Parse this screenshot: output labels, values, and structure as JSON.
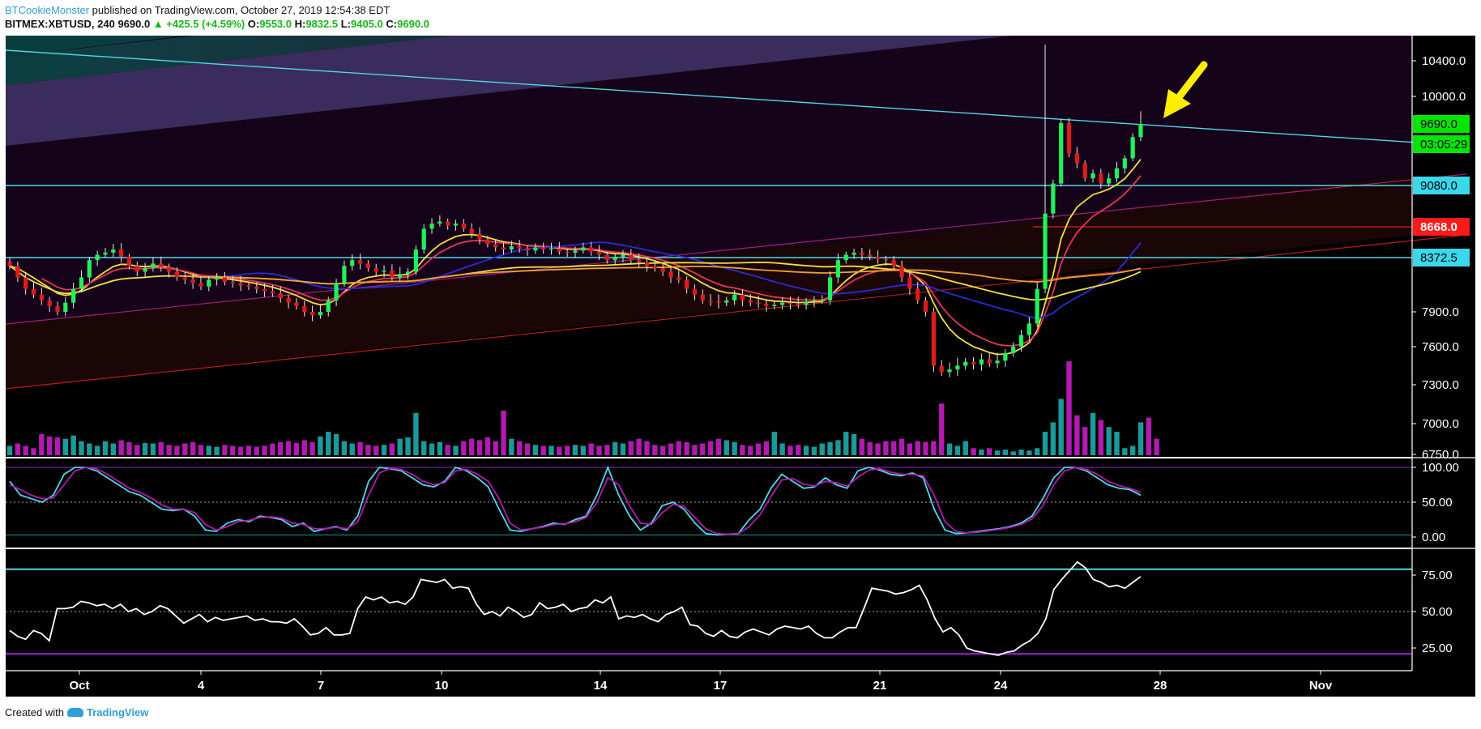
{
  "header": {
    "author": "BTCookieMonster",
    "published": "published on TradingView.com, October 27, 2019 12:54:38 EDT",
    "symbol": "BITMEX:XBTUSD, 240",
    "last": "9690.0",
    "change": "▲ +425.5 (+4.59%)",
    "o_label": "O:",
    "o_val": "9553.0",
    "h_label": "H:",
    "h_val": "9832.5",
    "l_label": "L:",
    "l_val": "9405.0",
    "c_label": "C:",
    "c_val": "9690.0"
  },
  "footer": {
    "created": "Created with",
    "brand": "TradingView"
  },
  "colors": {
    "background": "#000000",
    "up": "#1ef25a",
    "down": "#e01b1b",
    "cyan": "#4fd8e8",
    "yellow": "#f5df3c",
    "red_ma": "#e8345a",
    "blue_ma": "#2b2bd9",
    "orange_ma": "#f0a030",
    "white": "#ffffff",
    "magenta": "#b21ab2",
    "teal": "#1a9a9a",
    "purple": "#a020e0",
    "arrow": "#ffee00"
  },
  "chart_data": [
    {
      "type": "candlestick",
      "name": "price",
      "x_ticks": [
        "Oct",
        "4",
        "7",
        "10",
        "14",
        "17",
        "21",
        "24",
        "28",
        "Nov"
      ],
      "y_ticks": [
        "10400.0",
        "10000.0",
        "7900.0",
        "7600.0",
        "7300.0",
        "7000.0",
        "6750.0"
      ],
      "ylim": [
        6750,
        10700
      ],
      "price_labels": [
        {
          "text": "9690.0",
          "value": 9690,
          "style": "last"
        },
        {
          "text": "03:05:29",
          "value": 9560,
          "style": "timer"
        },
        {
          "text": "9080.0",
          "value": 9080,
          "style": "level"
        },
        {
          "text": "8668.0",
          "value": 8668,
          "style": "red-level"
        },
        {
          "text": "8372.5",
          "value": 8372.5,
          "style": "level"
        }
      ],
      "horizontal_levels": [
        9080,
        8372.5,
        8668
      ],
      "closes": [
        8300,
        8200,
        8100,
        8050,
        8000,
        7950,
        7900,
        7980,
        8100,
        8200,
        8350,
        8400,
        8420,
        8450,
        8380,
        8300,
        8250,
        8280,
        8320,
        8290,
        8250,
        8200,
        8180,
        8150,
        8120,
        8180,
        8200,
        8160,
        8150,
        8130,
        8120,
        8100,
        8080,
        8060,
        8020,
        7980,
        7950,
        7900,
        7870,
        7900,
        8000,
        8150,
        8300,
        8350,
        8320,
        8280,
        8250,
        8260,
        8200,
        8230,
        8250,
        8450,
        8650,
        8700,
        8720,
        8680,
        8700,
        8650,
        8600,
        8550,
        8500,
        8470,
        8450,
        8480,
        8460,
        8440,
        8470,
        8450,
        8460,
        8430,
        8420,
        8440,
        8470,
        8430,
        8400,
        8350,
        8380,
        8400,
        8350,
        8330,
        8300,
        8280,
        8250,
        8200,
        8180,
        8100,
        8050,
        8000,
        7990,
        7980,
        8000,
        8050,
        8000,
        7980,
        7970,
        7950,
        7960,
        7980,
        7970,
        7960,
        7990,
        8000,
        8000,
        8200,
        8350,
        8400,
        8420,
        8400,
        8380,
        8360,
        8350,
        8300,
        8200,
        8100,
        8000,
        7900,
        7450,
        7400,
        7420,
        7450,
        7480,
        7460,
        7500,
        7470,
        7490,
        7550,
        7600,
        7700,
        7800,
        8100,
        8800,
        9100,
        9700,
        9400,
        9300,
        9150,
        9200,
        9100,
        9150,
        9250,
        9350,
        9560,
        9690
      ],
      "volume": [
        0.2,
        0.25,
        0.2,
        0.15,
        0.45,
        0.4,
        0.38,
        0.35,
        0.42,
        0.3,
        0.25,
        0.2,
        0.3,
        0.25,
        0.32,
        0.28,
        0.22,
        0.26,
        0.25,
        0.28,
        0.22,
        0.2,
        0.25,
        0.28,
        0.22,
        0.2,
        0.18,
        0.22,
        0.2,
        0.18,
        0.2,
        0.18,
        0.2,
        0.25,
        0.28,
        0.3,
        0.26,
        0.32,
        0.28,
        0.4,
        0.5,
        0.45,
        0.3,
        0.25,
        0.28,
        0.22,
        0.2,
        0.22,
        0.25,
        0.35,
        0.38,
        0.9,
        0.3,
        0.25,
        0.28,
        0.22,
        0.2,
        0.3,
        0.35,
        0.32,
        0.38,
        0.3,
        0.95,
        0.35,
        0.3,
        0.25,
        0.22,
        0.2,
        0.2,
        0.18,
        0.2,
        0.22,
        0.2,
        0.25,
        0.2,
        0.22,
        0.28,
        0.25,
        0.3,
        0.35,
        0.3,
        0.22,
        0.2,
        0.25,
        0.3,
        0.28,
        0.22,
        0.25,
        0.3,
        0.35,
        0.32,
        0.28,
        0.22,
        0.2,
        0.25,
        0.3,
        0.5,
        0.25,
        0.2,
        0.22,
        0.2,
        0.18,
        0.25,
        0.28,
        0.32,
        0.5,
        0.45,
        0.35,
        0.28,
        0.25,
        0.3,
        0.3,
        0.35,
        0.25,
        0.3,
        0.28,
        0.3,
        1.1,
        0.25,
        0.2,
        0.3,
        0.15,
        0.12,
        0.15,
        0.1,
        0.12,
        0.08,
        0.12,
        0.1,
        0.15,
        0.5,
        0.7,
        1.2,
        2.0,
        0.85,
        0.6,
        0.9,
        0.75,
        0.6,
        0.5,
        0.15,
        0.2,
        0.7,
        0.8,
        0.35
      ]
    },
    {
      "type": "line",
      "name": "stochastic-rsi",
      "y_ticks": [
        "100.00",
        "50.00",
        "0.00"
      ],
      "ylim": [
        0,
        100
      ],
      "levels": [
        80,
        20
      ],
      "series": [
        {
          "color": "cyan",
          "values": [
            80,
            60,
            55,
            50,
            60,
            90,
            100,
            100,
            95,
            85,
            75,
            65,
            60,
            50,
            40,
            38,
            40,
            30,
            10,
            8,
            20,
            25,
            22,
            30,
            28,
            25,
            15,
            20,
            8,
            12,
            15,
            10,
            30,
            80,
            100,
            98,
            95,
            85,
            75,
            72,
            80,
            100,
            95,
            85,
            72,
            40,
            10,
            8,
            12,
            15,
            20,
            18,
            25,
            30,
            60,
            100,
            60,
            30,
            10,
            20,
            45,
            50,
            40,
            20,
            5,
            3,
            4,
            5,
            25,
            40,
            70,
            90,
            80,
            70,
            72,
            85,
            75,
            70,
            95,
            100,
            96,
            90,
            88,
            92,
            85,
            40,
            10,
            5,
            6,
            8,
            10,
            12,
            15,
            20,
            30,
            55,
            85,
            100,
            100,
            95,
            85,
            75,
            70,
            68,
            60
          ]
        },
        {
          "color": "magenta",
          "values": [
            75,
            68,
            60,
            55,
            56,
            75,
            95,
            100,
            98,
            90,
            80,
            70,
            64,
            56,
            46,
            40,
            40,
            35,
            18,
            10,
            15,
            22,
            24,
            28,
            29,
            27,
            20,
            18,
            12,
            12,
            14,
            12,
            22,
            60,
            92,
            99,
            97,
            90,
            80,
            75,
            78,
            95,
            97,
            90,
            80,
            55,
            20,
            10,
            12,
            14,
            18,
            19,
            22,
            28,
            50,
            85,
            75,
            45,
            20,
            18,
            35,
            47,
            44,
            28,
            12,
            5,
            4,
            5,
            15,
            32,
            58,
            82,
            84,
            76,
            73,
            80,
            78,
            73,
            86,
            96,
            98,
            93,
            90,
            90,
            88,
            60,
            22,
            8,
            6,
            7,
            9,
            11,
            14,
            18,
            26,
            45,
            75,
            95,
            100,
            97,
            90,
            80,
            74,
            70,
            64
          ]
        }
      ]
    },
    {
      "type": "line",
      "name": "rsi",
      "y_ticks": [
        "75.00",
        "50.00",
        "25.00"
      ],
      "ylim": [
        15,
        90
      ],
      "levels": [
        80,
        20
      ],
      "series": [
        {
          "color": "white",
          "values": [
            37,
            33,
            31,
            37,
            35,
            30,
            52,
            52,
            53,
            57,
            56,
            54,
            55,
            52,
            55,
            50,
            52,
            48,
            50,
            54,
            52,
            47,
            42,
            45,
            48,
            43,
            46,
            44,
            45,
            46,
            47,
            44,
            45,
            43,
            43,
            42,
            45,
            40,
            34,
            35,
            39,
            34,
            34,
            35,
            52,
            60,
            58,
            60,
            56,
            57,
            55,
            60,
            72,
            71,
            70,
            72,
            66,
            67,
            66,
            55,
            48,
            50,
            47,
            53,
            50,
            46,
            48,
            56,
            52,
            53,
            55,
            50,
            52,
            53,
            58,
            56,
            60,
            45,
            47,
            46,
            48,
            45,
            43,
            48,
            50,
            53,
            41,
            40,
            35,
            33,
            37,
            33,
            32,
            36,
            38,
            36,
            34,
            38,
            40,
            39,
            38,
            40,
            35,
            32,
            32,
            36,
            39,
            39,
            52,
            66,
            65,
            64,
            62,
            63,
            65,
            68,
            58,
            45,
            36,
            39,
            34,
            25,
            23,
            22,
            21,
            20,
            22,
            23,
            27,
            30,
            35,
            45,
            65,
            72,
            78,
            84,
            80,
            72,
            70,
            67,
            68,
            66,
            70,
            74
          ]
        }
      ]
    }
  ]
}
